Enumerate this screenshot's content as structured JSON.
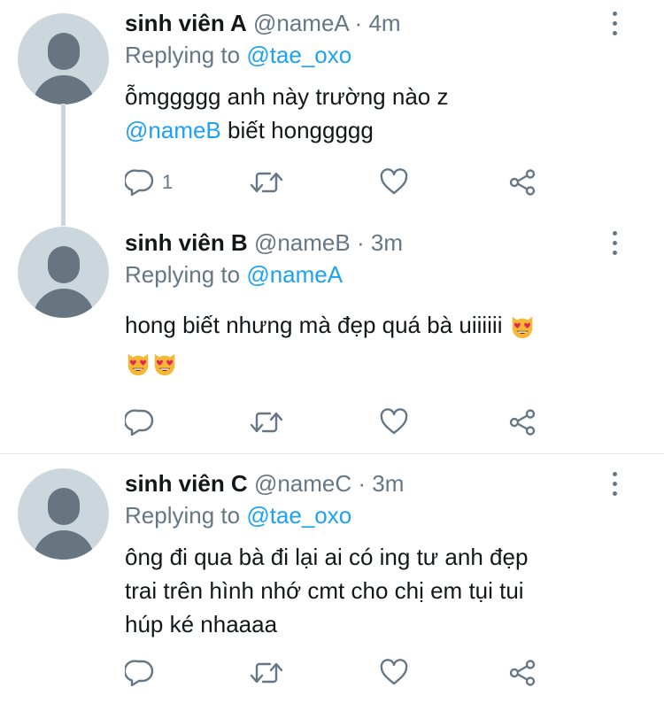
{
  "tweets": [
    {
      "name": "sinh viên A",
      "handle": "@nameA",
      "sep": "·",
      "time": "4m",
      "replying_prefix": "Replying to",
      "replying_to": "@tae_oxo",
      "text_line1": "ỗmggggg anh này trường nào z",
      "text_mention": "@nameB",
      "text_line2_rest": " biết honggggg",
      "reply_count": "1"
    },
    {
      "name": "sinh viên B",
      "handle": "@nameB",
      "sep": "·",
      "time": "3m",
      "replying_prefix": "Replying to",
      "replying_to": "@nameA",
      "text_line1": "hong biết nhưng mà đẹp quá bà uiiiiii",
      "reply_count": ""
    },
    {
      "name": "sinh viên C",
      "handle": "@nameC",
      "sep": "·",
      "time": "3m",
      "replying_prefix": "Replying to",
      "replying_to": "@tae_oxo",
      "text_line1": "ông đi qua bà đi lại ai có ing tư anh đẹp",
      "text_line2": "trai trên hình nhớ cmt cho chị em tụi tui",
      "text_line3": "húp ké nhaaaa",
      "reply_count": ""
    }
  ],
  "icons": {
    "reply": "speech-bubble-icon",
    "retweet": "retweet-arrows-icon",
    "like": "heart-outline-icon",
    "share": "share-nodes-icon",
    "more": "vertical-ellipsis-icon",
    "emoji": "smiling-cat-heart-eyes-emoji"
  },
  "colors": {
    "text": "#14171a",
    "secondary": "#657786",
    "link": "#1da1f2",
    "avatar_bg": "#ccd6dd",
    "divider": "#e1e8ed"
  }
}
